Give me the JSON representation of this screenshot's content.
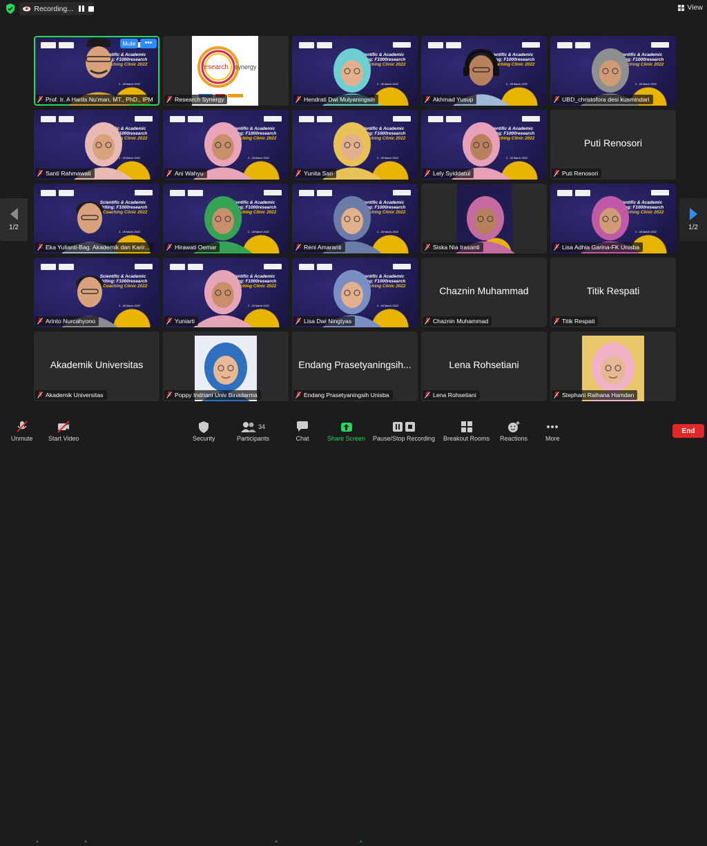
{
  "topbar": {
    "recording_label": "Recording...",
    "view_label": "View"
  },
  "page_nav": {
    "left_page": "1/2",
    "right_page": "1/2"
  },
  "banner": {
    "title_line1": "Scientific & Academic",
    "title_line2": "Writing: F1000research",
    "title_line3": "E-Coaching Clinic 2022",
    "date": "2 - 28 March 2022"
  },
  "tile_controls": {
    "mute_label": "Mute",
    "more_label": "•••"
  },
  "participants": [
    {
      "name": "Prof. Ir. A Harits Nu'man, MT., PhD., IPM",
      "type": "video"
    },
    {
      "name": "Research Synergy",
      "type": "logo",
      "logo_text_1": "research",
      "logo_text_2": "synergy"
    },
    {
      "name": "Hendrati Dwi Mulyaningsih",
      "type": "video"
    },
    {
      "name": "Akhmad Yusup",
      "type": "video"
    },
    {
      "name": "UBD_christofora desi kusmindari",
      "type": "video"
    },
    {
      "name": "Santi Rahmawati",
      "type": "video"
    },
    {
      "name": "Ani Wahyu",
      "type": "video"
    },
    {
      "name": "Yunita Sari",
      "type": "video"
    },
    {
      "name": "Lely Syiddatul",
      "type": "video"
    },
    {
      "name": "Puti Renosori",
      "type": "name",
      "big": "Puti Renosori"
    },
    {
      "name": "Eka Yulianti-Bag. Akademik dan Karir...",
      "type": "video"
    },
    {
      "name": "Hirawati Oemar",
      "type": "video"
    },
    {
      "name": "Reni Amaranti",
      "type": "video"
    },
    {
      "name": "Siska Nia Irasanti",
      "type": "video"
    },
    {
      "name": "Lisa Adhia Garina-FK Unisba",
      "type": "video"
    },
    {
      "name": "Arinto Nurcahyono",
      "type": "video"
    },
    {
      "name": "Yuniarti",
      "type": "video"
    },
    {
      "name": "Lisa Dwi Ningtyas",
      "type": "video"
    },
    {
      "name": "Chaznin  Muhammad",
      "type": "name",
      "big": "Chaznin  Muhammad"
    },
    {
      "name": "Titik Respati",
      "type": "name",
      "big": "Titik Respati"
    },
    {
      "name": "Akademik Universitas",
      "type": "name",
      "big": "Akademik Universitas"
    },
    {
      "name": "Poppy Indriani Univ Binadarma",
      "type": "photo"
    },
    {
      "name": "Endang Prasetyaningsih Unisba",
      "type": "name",
      "big": "Endang Prasetyaningsih..."
    },
    {
      "name": "Lena Rohsetiani",
      "type": "name",
      "big": "Lena Rohsetiani"
    },
    {
      "name": "Stephani Raihana Hamdan",
      "type": "photo"
    }
  ],
  "toolbar": {
    "unmute": "Unmute",
    "start_video": "Start Video",
    "security": "Security",
    "participants": "Participants",
    "participants_count": "34",
    "chat": "Chat",
    "share_screen": "Share Screen",
    "pause_stop_recording": "Pause/Stop Recording",
    "breakout_rooms": "Breakout Rooms",
    "reactions": "Reactions",
    "more": "More",
    "end": "End"
  },
  "colors": {
    "active_speaker_border": "#23d959",
    "accent_blue": "#2d8cff",
    "end_red": "#e02828",
    "banner_purple": "#231d5a",
    "banner_yellow": "#e8b400"
  }
}
